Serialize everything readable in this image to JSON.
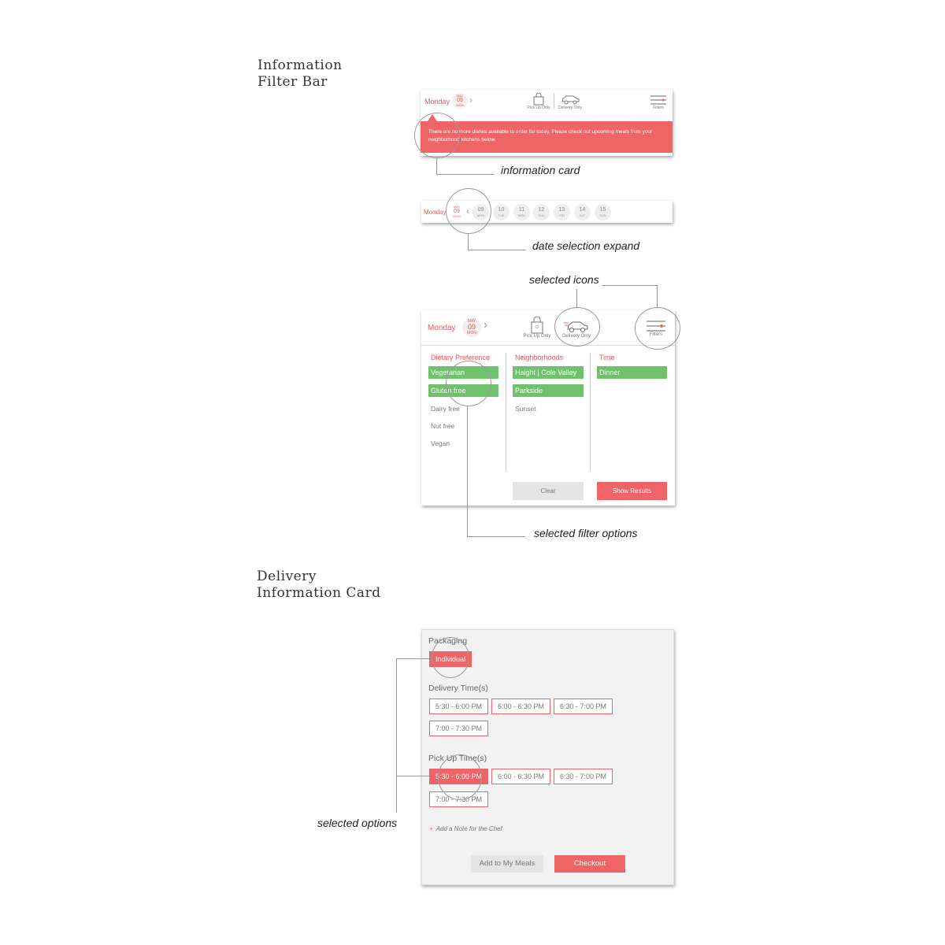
{
  "sections": {
    "filter_bar_title_line1": "Information",
    "filter_bar_title_line2": "Filter Bar",
    "delivery_title_line1": "Delivery",
    "delivery_title_line2": "Information Card"
  },
  "annotations": {
    "information_card": "information card",
    "date_selection_expand": "date selection expand",
    "selected_icons": "selected icons",
    "selected_filter_options": "selected filter options",
    "selected_options": "selected options"
  },
  "top_bar": {
    "day_label": "Monday",
    "month": "MAY",
    "date": "09",
    "weekday": "MON",
    "pickup_label": "Pick Up Only",
    "delivery_label": "Delivery Only",
    "filters_label": "Filters"
  },
  "info_card": {
    "message": "There are no more dishes available to order for today. Please check out upcoming meals from your neighborhood kitchens below."
  },
  "date_strip": [
    {
      "date": "09",
      "weekday": "MON"
    },
    {
      "date": "10",
      "weekday": "TUE"
    },
    {
      "date": "11",
      "weekday": "WED"
    },
    {
      "date": "12",
      "weekday": "THU"
    },
    {
      "date": "13",
      "weekday": "FRI"
    },
    {
      "date": "14",
      "weekday": "SAT"
    },
    {
      "date": "15",
      "weekday": "SUN"
    }
  ],
  "filters": {
    "dietary": {
      "heading": "Dietary Preference",
      "options": [
        "Vegetarian",
        "Gluten free",
        "Dairy free",
        "Nut free",
        "Vegan"
      ],
      "selected": [
        "Vegetarian",
        "Gluten free"
      ]
    },
    "neighborhoods": {
      "heading": "Neighborhoods",
      "options": [
        "Haight | Cole Valley",
        "Parkside",
        "Sunset"
      ],
      "selected": [
        "Haight | Cole Valley",
        "Parkside"
      ]
    },
    "time": {
      "heading": "Time",
      "options": [
        "Dinner"
      ],
      "selected": [
        "Dinner"
      ]
    },
    "clear_label": "Clear",
    "show_results_label": "Show Results"
  },
  "delivery_card": {
    "packaging_heading": "Packaging",
    "packaging_option": "Individual",
    "delivery_heading": "Delivery Time(s)",
    "delivery_slots": [
      "5:30 - 6:00 PM",
      "6:00 - 6:30 PM",
      "6:30 - 7:00 PM",
      "7:00 - 7:30 PM"
    ],
    "pickup_heading": "Pick Up Time(s)",
    "pickup_slots": [
      "5:30 - 6:00 PM",
      "6:00 - 6:30 PM",
      "6:30 - 7:00 PM",
      "7:00 - 7:30 PM"
    ],
    "pickup_selected": "5:30 - 6:00 PM",
    "note_plus": "+",
    "note_label": "Add a Note for the Chef",
    "add_label": "Add to My Meals",
    "checkout_label": "Checkout"
  },
  "colors": {
    "accent": "#ef6466",
    "selected_green": "#6fc26b",
    "chip_bg": "#eeeeee"
  }
}
